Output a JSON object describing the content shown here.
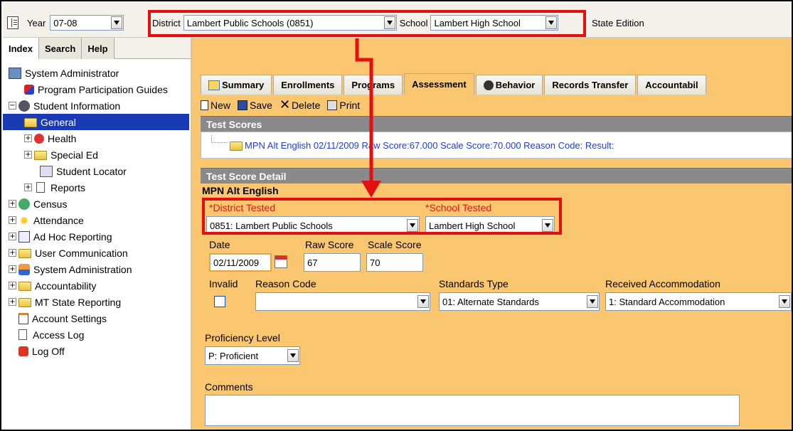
{
  "topbar": {
    "year_label": "Year",
    "year_value": "07-08",
    "district_label": "District",
    "district_value": "Lambert Public Schools (0851)",
    "school_label": "School",
    "school_value": "Lambert High School",
    "edition": "State Edition"
  },
  "left_tabs": [
    "Index",
    "Search",
    "Help"
  ],
  "tree": [
    {
      "label": "System Administrator",
      "icon": "admin-icon"
    },
    {
      "label": "Program Participation Guides",
      "icon": "guide-icon"
    },
    {
      "label": "Student Information",
      "icon": "student-icon"
    },
    {
      "label": "General",
      "icon": "folder-icon"
    },
    {
      "label": "Health",
      "icon": "health-icon"
    },
    {
      "label": "Special Ed",
      "icon": "folder-icon"
    },
    {
      "label": "Student Locator",
      "icon": "locator-icon"
    },
    {
      "label": "Reports",
      "icon": "document-icon"
    },
    {
      "label": "Census",
      "icon": "census-icon"
    },
    {
      "label": "Attendance",
      "icon": "attendance-icon"
    },
    {
      "label": "Ad Hoc Reporting",
      "icon": "adhoc-icon"
    },
    {
      "label": "User Communication",
      "icon": "folder-icon"
    },
    {
      "label": "System Administration",
      "icon": "system-icon"
    },
    {
      "label": "Accountability",
      "icon": "folder-icon"
    },
    {
      "label": "MT State Reporting",
      "icon": "folder-icon"
    },
    {
      "label": "Account Settings",
      "icon": "settings-icon"
    },
    {
      "label": "Access Log",
      "icon": "document-icon"
    },
    {
      "label": "Log Off",
      "icon": "logoff-icon"
    }
  ],
  "tabs": [
    "Summary",
    "Enrollments",
    "Programs",
    "Assessment",
    "Behavior",
    "Records Transfer",
    "Accountabil"
  ],
  "active_tab": "Assessment",
  "toolbar": {
    "new": "New",
    "save": "Save",
    "delete": "Delete",
    "print": "Print"
  },
  "test_scores": {
    "header": "Test Scores",
    "entry": "MPN Alt English 02/11/2009 Raw Score:67.000 Scale Score:70.000 Reason Code: Result:"
  },
  "detail": {
    "header": "Test Score Detail",
    "test_name": "MPN Alt English",
    "district_tested_label": "*District Tested",
    "district_tested_value": "0851: Lambert Public Schools",
    "school_tested_label": "*School Tested",
    "school_tested_value": "Lambert High School",
    "date_label": "Date",
    "date_value": "02/11/2009",
    "raw_score_label": "Raw Score",
    "raw_score_value": "67",
    "scale_score_label": "Scale Score",
    "scale_score_value": "70",
    "invalid_label": "Invalid",
    "reason_code_label": "Reason Code",
    "reason_code_value": "",
    "standards_type_label": "Standards Type",
    "standards_type_value": "01: Alternate Standards",
    "received_accommodation_label": "Received Accommodation",
    "received_accommodation_value": "1: Standard Accommodation",
    "proficiency_label": "Proficiency Level",
    "proficiency_value": "P: Proficient",
    "comments_label": "Comments",
    "comments_value": ""
  },
  "colors": {
    "highlight_red": "#e41010",
    "panel_orange": "#fac670",
    "link_blue": "#1f3fd0",
    "selected_node": "#1a3bb5"
  }
}
